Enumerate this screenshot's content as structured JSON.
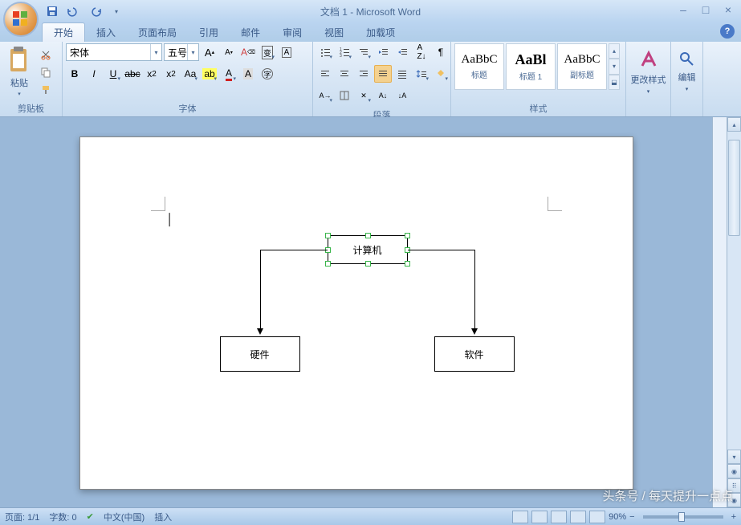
{
  "title": "文档 1 - Microsoft Word",
  "tabs": {
    "t0": "开始",
    "t1": "插入",
    "t2": "页面布局",
    "t3": "引用",
    "t4": "邮件",
    "t5": "审阅",
    "t6": "视图",
    "t7": "加载项"
  },
  "clipboard": {
    "paste": "粘贴",
    "group": "剪贴板"
  },
  "font": {
    "group": "字体",
    "name": "宋体",
    "size": "五号",
    "grow": "A",
    "shrink": "A",
    "clear": "A",
    "phonetic": "拼",
    "charborder": "字",
    "box": "A"
  },
  "para": {
    "group": "段落"
  },
  "styles": {
    "group": "样式",
    "s1_prev": "AaBbC",
    "s1_name": "标题",
    "s2_prev": "AaBl",
    "s2_name": "标题 1",
    "s3_prev": "AaBbC",
    "s3_name": "副标题"
  },
  "change": {
    "label": "更改样式"
  },
  "edit": {
    "label": "编辑"
  },
  "diagram": {
    "root": "计算机",
    "left": "硬件",
    "right": "软件"
  },
  "status": {
    "page": "页面: 1/1",
    "words": "字数: 0",
    "lang": "中文(中国)",
    "mode": "插入",
    "zoom": "90%"
  },
  "watermark": "头条号 / 每天提升一点点"
}
